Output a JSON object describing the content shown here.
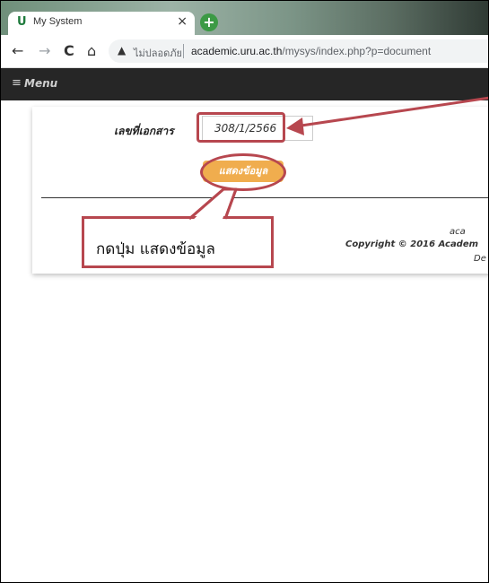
{
  "browser": {
    "tab_favicon": "U",
    "tab_title": "My System",
    "tab_close": "×",
    "new_tab": "+",
    "nav_back": "←",
    "nav_forward": "→",
    "nav_reload": "C",
    "nav_home": "⌂",
    "insecure_label": "ไม่ปลอดภัย",
    "url_host": "academic.uru.ac.th",
    "url_path": "/mysys/index.php?p=document"
  },
  "app": {
    "menu_label": "Menu"
  },
  "form": {
    "doc_label": "เลขที่เอกสาร",
    "doc_value": "308/1/2566",
    "show_button": "แสดงข้อมูล"
  },
  "footer": {
    "line1": "aca",
    "line2": "Copyright © 2016 Academ",
    "line3": "De"
  },
  "annotation": {
    "callout_text": "กดปุ่ม แสดงข้อมูล",
    "color": "#b7474f"
  }
}
